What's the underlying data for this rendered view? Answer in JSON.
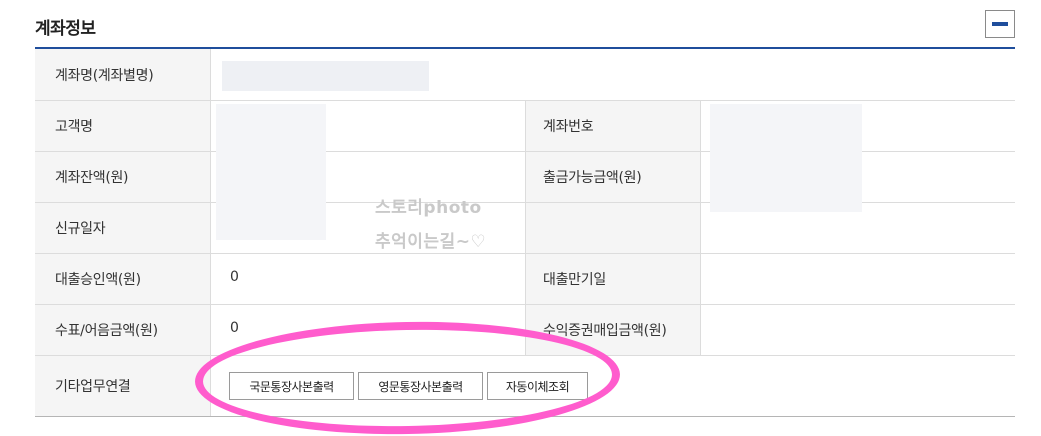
{
  "header": {
    "title": "계좌정보",
    "collapse_icon": "minus-icon"
  },
  "rows": [
    {
      "label": "계좌명(계좌별명)",
      "value": ""
    },
    {
      "label": "고객명",
      "value": "",
      "label2": "계좌번호",
      "value2": ""
    },
    {
      "label": "계좌잔액(원)",
      "value": "",
      "label2": "출금가능금액(원)",
      "value2": ""
    },
    {
      "label": "신규일자",
      "value": "",
      "label2": "",
      "value2": ""
    },
    {
      "label": "대출승인액(원)",
      "value": "0",
      "label2": "대출만기일",
      "value2": ""
    },
    {
      "label": "수표/어음금액(원)",
      "value": "0",
      "label2": "수익증권매입금액(원)",
      "value2": ""
    },
    {
      "label": "기타업무연결"
    }
  ],
  "buttons": [
    {
      "label": "국문통장사본출력"
    },
    {
      "label": "영문통장사본출력"
    },
    {
      "label": "자동이체조회"
    }
  ],
  "watermark": {
    "line1": "스토리photo",
    "line2": "추억이는길~♡"
  },
  "colors": {
    "accent": "#1f4e9c",
    "highlight": "#ff5ccd",
    "label_bg": "#f5f5f5"
  }
}
